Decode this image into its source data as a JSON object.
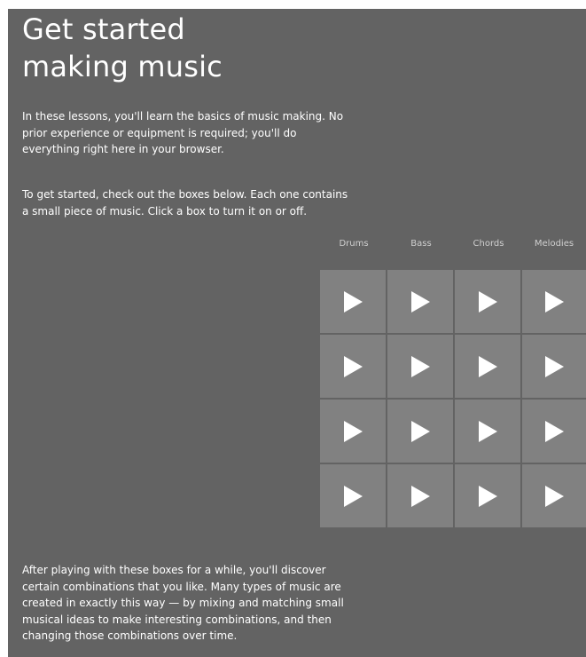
{
  "title": {
    "line1": "Get started",
    "line2": "making music"
  },
  "intro": {
    "paragraph1": "In these lessons, you'll learn the basics of music making. No prior experience or equipment is required; you'll do everything right here in your browser.",
    "paragraph2": "To get started, check out the boxes below. Each one contains a small piece of music. Click a box to turn it on or off."
  },
  "grid": {
    "columns": [
      "Drums",
      "Bass",
      "Chords",
      "Melodies"
    ],
    "rows": 4,
    "cell_icon": "play-icon",
    "cell_color": "#818181",
    "background_color": "#636363"
  },
  "outro": {
    "paragraph": "After playing with these boxes for a while, you'll discover certain combinations that you like. Many types of music are created in exactly this way — by mixing and matching small musical ideas to make interesting combinations, and then changing those combinations over time."
  }
}
